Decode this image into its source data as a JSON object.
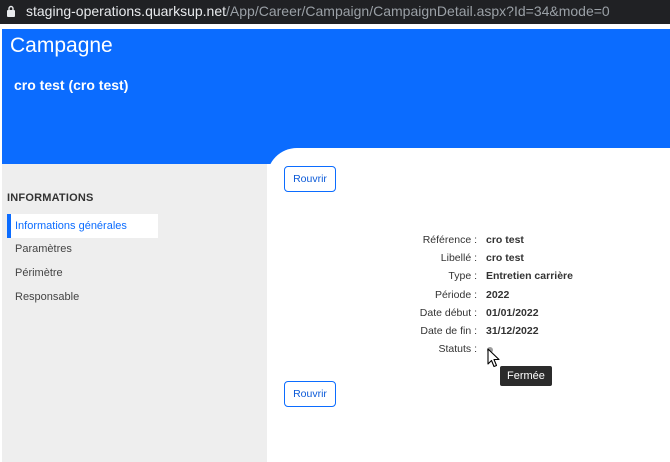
{
  "browser": {
    "url_host": "staging-operations.quarksup.net",
    "url_path": "/App/Career/Campaign/CampaignDetail.aspx?Id=34&mode=0"
  },
  "header": {
    "title": "Campagne",
    "campaign_name": "cro test (cro test)",
    "background_color": "#0b6cff"
  },
  "sidebar": {
    "heading": "INFORMATIONS",
    "items": [
      {
        "label": "Informations générales",
        "active": true
      },
      {
        "label": "Paramètres",
        "active": false
      },
      {
        "label": "Périmètre",
        "active": false
      },
      {
        "label": "Responsable",
        "active": false
      }
    ]
  },
  "actions": {
    "reopen_label": "Rouvrir"
  },
  "details": [
    {
      "label": "Référence :",
      "value": "cro test"
    },
    {
      "label": "Libellé :",
      "value": "cro test"
    },
    {
      "label": "Type :",
      "value": "Entretien carrière"
    },
    {
      "label": "Période :",
      "value": "2022"
    },
    {
      "label": "Date début :",
      "value": "01/01/2022"
    },
    {
      "label": "Date de fin :",
      "value": "31/12/2022"
    },
    {
      "label": "Statuts :",
      "value": ""
    }
  ],
  "status": {
    "tooltip": "Fermée",
    "icon": "status-dot-icon"
  }
}
